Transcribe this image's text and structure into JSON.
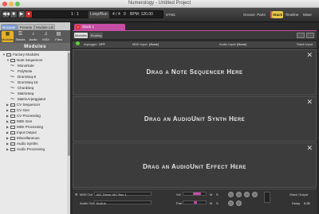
{
  "window": {
    "title": "Numerology - Untitled Project"
  },
  "colors": {
    "close": "#ec5b54",
    "minimize": "#f3bd4f",
    "zoom": "#62c554",
    "stack_accent": "#c54ea5",
    "power_on": "#5fcf3a"
  },
  "transport": {
    "rewind_icon": "rewind-icon",
    "stop_icon": "stop-icon",
    "play_icon": "play-icon",
    "record_icon": "record-icon",
    "position": "1 : 1",
    "mode": "Loop/Run",
    "time_sig": "4 / 4",
    "swing": "0",
    "bpm": "BPM: 120.00",
    "sync": "SYNC",
    "nav": [
      {
        "label": "Groove"
      },
      {
        "label": "Parts"
      },
      {
        "label": "Stack",
        "active": true
      },
      {
        "label": "Timeline"
      },
      {
        "label": "Mixer"
      }
    ]
  },
  "sidebar": {
    "tabs": [
      "Browser",
      "Presets",
      "Module Lib"
    ],
    "icons": [
      {
        "label": "Modules",
        "icon": "modules-icon",
        "active": true
      },
      {
        "label": "Stacks",
        "icon": "stacks-icon"
      },
      {
        "label": "Audio",
        "icon": "audio-icon"
      },
      {
        "label": "MIDI",
        "icon": "midi-icon"
      },
      {
        "label": "Files",
        "icon": "files-icon"
      }
    ],
    "header": "Modules",
    "tree": [
      {
        "label": "Factory Modules",
        "level": 0,
        "folder": true
      },
      {
        "label": "Note Sequencer",
        "level": 1,
        "folder": true
      },
      {
        "label": "MonoNote",
        "level": 2,
        "folder": false
      },
      {
        "label": "PolyNote",
        "level": 2,
        "folder": false
      },
      {
        "label": "DrumSeq-8",
        "level": 2,
        "folder": false
      },
      {
        "label": "DrumSeq-16",
        "level": 2,
        "folder": false
      },
      {
        "label": "ChordSeq",
        "level": 2,
        "folder": false
      },
      {
        "label": "MatrixSeq",
        "level": 2,
        "folder": false
      },
      {
        "label": "MatrixArpeggiator",
        "level": 2,
        "folder": false
      },
      {
        "label": "CV Sequencer",
        "level": 1,
        "folder": true
      },
      {
        "label": "CV Gen",
        "level": 1,
        "folder": true
      },
      {
        "label": "CV Processing",
        "level": 1,
        "folder": true
      },
      {
        "label": "MIDI Gen",
        "level": 1,
        "folder": true
      },
      {
        "label": "MIDI Processing",
        "level": 1,
        "folder": true
      },
      {
        "label": "Input Output",
        "level": 1,
        "folder": true
      },
      {
        "label": "Miscellaneous",
        "level": 1,
        "folder": true
      },
      {
        "label": "Audio Synths",
        "level": 1,
        "folder": true
      },
      {
        "label": "Audio Processing",
        "level": 1,
        "folder": true
      }
    ]
  },
  "stack": {
    "tab_label": "Stack 1",
    "modes": [
      "Modules",
      "Routing"
    ],
    "arp_bar": {
      "arpeggio": "Arpeggio:",
      "arpeggio_value": "OFF",
      "midi_input": "MIDI Input:",
      "midi_input_value": "(None)",
      "audio_input": "Audio Input:",
      "audio_input_value": "(None)",
      "stack_input": "Stack Input"
    },
    "slots": [
      {
        "label": "Drag a Note Sequencer Here"
      },
      {
        "label": "Drag an AudioUnit Synth Here"
      },
      {
        "label": "Drag an AudioUnit Effect Here"
      }
    ],
    "bottom": {
      "midi_out_label": "MIDI Out",
      "midi_out_value": "IAC Driver IAC Bus 1",
      "audio_out_label": "Audio Out",
      "audio_out_value": "Built-in",
      "vol_label": "Vol",
      "pan_label": "Pan",
      "m": "M",
      "s": "S",
      "stack_output": "Stack Output",
      "delay_label": "Delay",
      "delay_value": "0.00"
    }
  }
}
